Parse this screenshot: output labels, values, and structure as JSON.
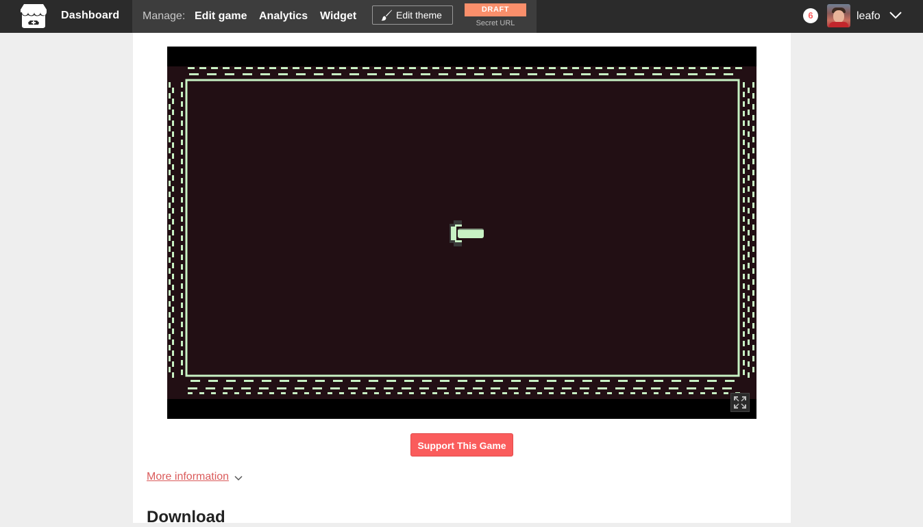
{
  "header": {
    "dashboard_label": "Dashboard",
    "manage_label": "Manage:",
    "nav": {
      "edit_game": "Edit game",
      "analytics": "Analytics",
      "widget": "Widget"
    },
    "edit_theme_label": "Edit theme",
    "draft_badge": "DRAFT",
    "secret_url_label": "Secret URL",
    "notification_count": "6",
    "username": "leafo"
  },
  "main": {
    "support_button": "Support This Game",
    "more_info_link": "More information",
    "download_heading": "Download"
  },
  "colors": {
    "topbar": "#2b2b2b",
    "manage_bar": "#3d3d3d",
    "accent": "#fa5c5c",
    "draft": "#fa8f6b",
    "game_background": "#220f14",
    "game_foreground": "#c8f2c4"
  },
  "icons": {
    "logo": "itchio-logo-icon",
    "edit_theme": "paintbrush-icon",
    "user_menu": "chevron-down-icon",
    "more_info": "chevron-down-icon",
    "fullscreen": "fullscreen-icon"
  }
}
